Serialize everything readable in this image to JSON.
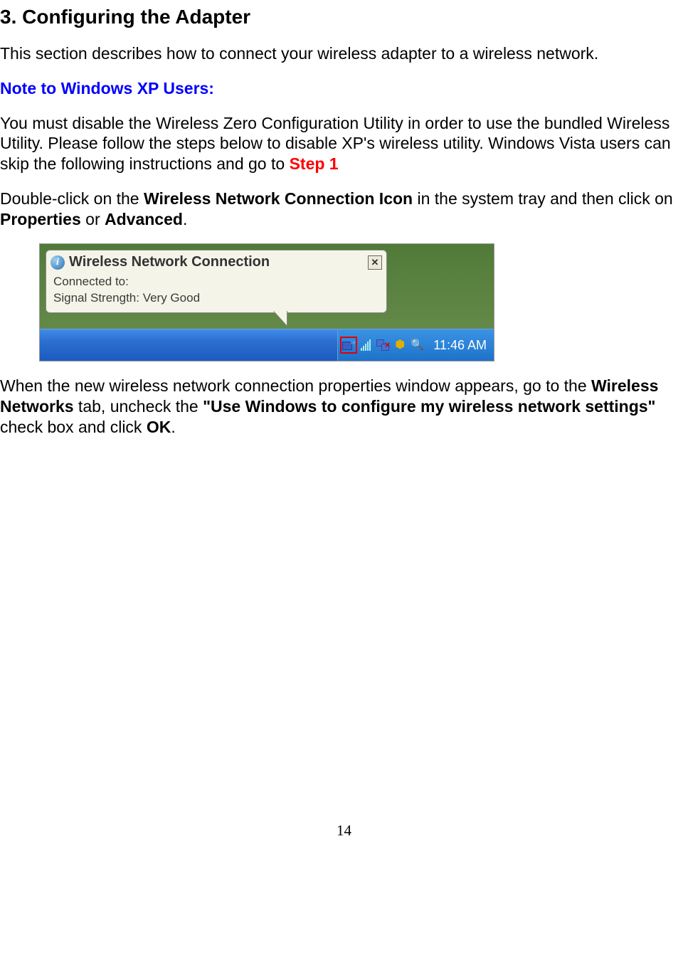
{
  "heading": "3. Configuring the Adapter",
  "intro": "This section describes how to connect your wireless adapter to a wireless network.",
  "note_title": "Note to Windows XP Users:",
  "note_body_part1": "You must disable the Wireless Zero Configuration Utility in order to use the bundled Wireless Utility.  Please follow the steps below to disable XP's wireless utility.  Windows Vista users can skip the following instructions and go to ",
  "note_body_step": "Step 1",
  "para2_part1": "Double-click on the ",
  "para2_bold1": "Wireless Network Connection Icon",
  "para2_part2": " in the system tray and then click on ",
  "para2_bold2": "Properties",
  "para2_part3": " or ",
  "para2_bold3": "Advanced",
  "para2_part4": ".",
  "balloon": {
    "title": "Wireless Network Connection",
    "line1": "Connected to:",
    "line2": "Signal Strength: Very Good"
  },
  "tray_time": "11:46 AM",
  "para3_part1": "When the new wireless network connection properties window appears, go to the ",
  "para3_bold1": "Wireless Networks",
  "para3_part2": " tab, uncheck the ",
  "para3_bold2": "\"Use Windows to configure my wireless network settings\"",
  "para3_part3": " check box and click ",
  "para3_bold3": "OK",
  "para3_part4": ".",
  "page_number": "14"
}
